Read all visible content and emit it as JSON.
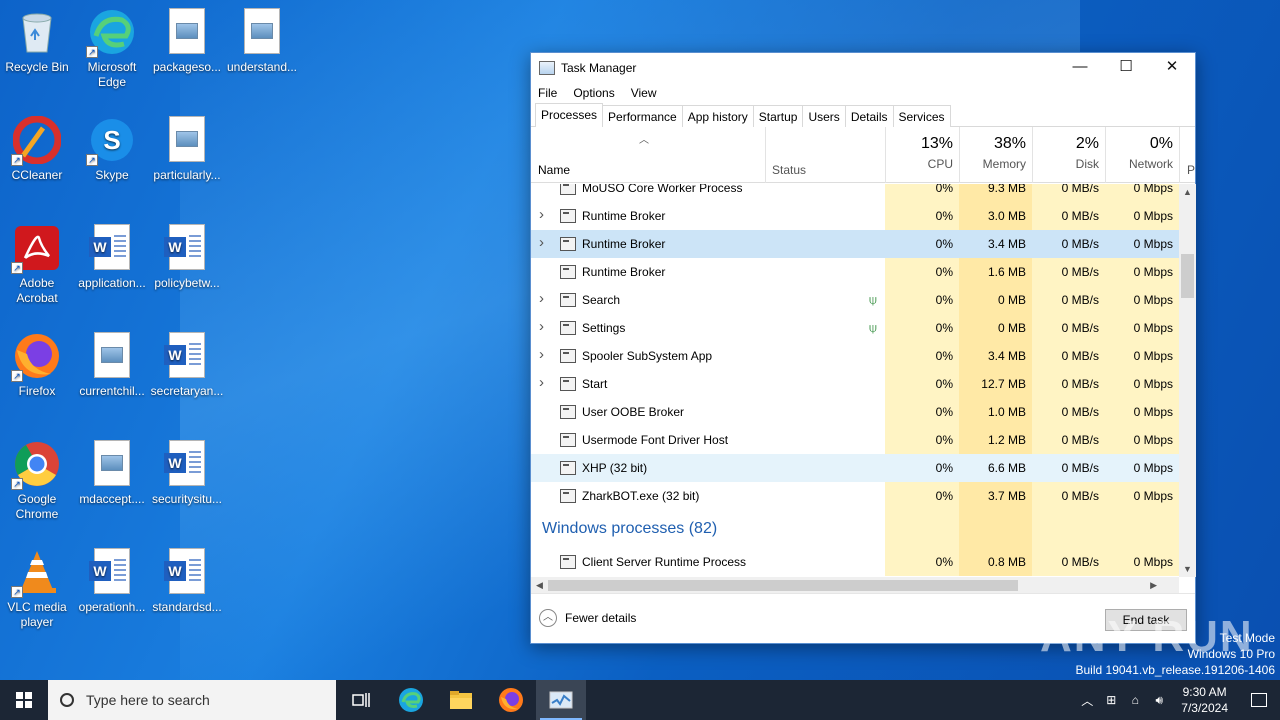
{
  "desktop": {
    "icons": [
      {
        "label": "Recycle Bin",
        "type": "recycle"
      },
      {
        "label": "Microsoft Edge",
        "type": "edge"
      },
      {
        "label": "packageso...",
        "type": "image-doc"
      },
      {
        "label": "understand...",
        "type": "image-doc"
      },
      {
        "label": "CCleaner",
        "type": "ccleaner"
      },
      {
        "label": "Skype",
        "type": "skype"
      },
      {
        "label": "particularly...",
        "type": "image-doc"
      },
      {
        "label": "Adobe Acrobat",
        "type": "acrobat"
      },
      {
        "label": "application...",
        "type": "word-doc"
      },
      {
        "label": "policybetw...",
        "type": "word-doc"
      },
      {
        "label": "Firefox",
        "type": "firefox"
      },
      {
        "label": "currentchil...",
        "type": "image-doc"
      },
      {
        "label": "secretaryan...",
        "type": "word-doc"
      },
      {
        "label": "Google Chrome",
        "type": "chrome"
      },
      {
        "label": "mdaccept....",
        "type": "image-doc"
      },
      {
        "label": "securitysitu...",
        "type": "word-doc"
      },
      {
        "label": "VLC media player",
        "type": "vlc"
      },
      {
        "label": "operationh...",
        "type": "word-doc"
      },
      {
        "label": "standardsd...",
        "type": "word-doc"
      }
    ]
  },
  "window": {
    "title": "Task Manager",
    "controls": {
      "minimize": "—",
      "maximize": "☐",
      "close": "✕"
    },
    "menu": [
      "File",
      "Options",
      "View"
    ],
    "tabs": [
      "Processes",
      "Performance",
      "App history",
      "Startup",
      "Users",
      "Details",
      "Services"
    ],
    "active_tab": "Processes",
    "columns": {
      "name": "Name",
      "status": "Status",
      "cpu": {
        "pct": "13%",
        "label": "CPU"
      },
      "memory": {
        "pct": "38%",
        "label": "Memory"
      },
      "disk": {
        "pct": "2%",
        "label": "Disk"
      },
      "network": {
        "pct": "0%",
        "label": "Network"
      },
      "power": "P"
    },
    "rows": [
      {
        "name": "MoUSO Core Worker Process",
        "expand": false,
        "leaf": false,
        "cpu": "0%",
        "mem": "9.3 MB",
        "disk": "0 MB/s",
        "net": "0 Mbps",
        "state": "",
        "partial": true
      },
      {
        "name": "Runtime Broker",
        "expand": true,
        "leaf": false,
        "cpu": "0%",
        "mem": "3.0 MB",
        "disk": "0 MB/s",
        "net": "0 Mbps",
        "state": ""
      },
      {
        "name": "Runtime Broker",
        "expand": true,
        "leaf": false,
        "cpu": "0%",
        "mem": "3.4 MB",
        "disk": "0 MB/s",
        "net": "0 Mbps",
        "state": "sel"
      },
      {
        "name": "Runtime Broker",
        "expand": false,
        "leaf": false,
        "cpu": "0%",
        "mem": "1.6 MB",
        "disk": "0 MB/s",
        "net": "0 Mbps",
        "state": ""
      },
      {
        "name": "Search",
        "expand": true,
        "leaf": true,
        "cpu": "0%",
        "mem": "0 MB",
        "disk": "0 MB/s",
        "net": "0 Mbps",
        "state": ""
      },
      {
        "name": "Settings",
        "expand": true,
        "leaf": true,
        "cpu": "0%",
        "mem": "0 MB",
        "disk": "0 MB/s",
        "net": "0 Mbps",
        "state": ""
      },
      {
        "name": "Spooler SubSystem App",
        "expand": true,
        "leaf": false,
        "cpu": "0%",
        "mem": "3.4 MB",
        "disk": "0 MB/s",
        "net": "0 Mbps",
        "state": ""
      },
      {
        "name": "Start",
        "expand": true,
        "leaf": false,
        "cpu": "0%",
        "mem": "12.7 MB",
        "disk": "0 MB/s",
        "net": "0 Mbps",
        "state": ""
      },
      {
        "name": "User OOBE Broker",
        "expand": false,
        "leaf": false,
        "cpu": "0%",
        "mem": "1.0 MB",
        "disk": "0 MB/s",
        "net": "0 Mbps",
        "state": ""
      },
      {
        "name": "Usermode Font Driver Host",
        "expand": false,
        "leaf": false,
        "cpu": "0%",
        "mem": "1.2 MB",
        "disk": "0 MB/s",
        "net": "0 Mbps",
        "state": ""
      },
      {
        "name": "XHP (32 bit)",
        "expand": false,
        "leaf": false,
        "cpu": "0%",
        "mem": "6.6 MB",
        "disk": "0 MB/s",
        "net": "0 Mbps",
        "state": "hov"
      },
      {
        "name": "ZharkBOT.exe (32 bit)",
        "expand": false,
        "leaf": false,
        "cpu": "0%",
        "mem": "3.7 MB",
        "disk": "0 MB/s",
        "net": "0 Mbps",
        "state": ""
      }
    ],
    "group_title": "Windows processes (82)",
    "after_group_row": {
      "name": "Client Server Runtime Process",
      "cpu": "0%",
      "mem": "0.8 MB",
      "disk": "0 MB/s",
      "net": "0 Mbps"
    },
    "footer": {
      "fewer_details": "Fewer details",
      "end_task": "End task"
    }
  },
  "watermark": {
    "text": "ANY RUN",
    "test_mode": "Test Mode",
    "edition": "Windows 10 Pro",
    "build": "Build 19041.vb_release.191206-1406"
  },
  "taskbar": {
    "search_placeholder": "Type here to search",
    "time": "9:30 AM",
    "date": "7/3/2024"
  }
}
